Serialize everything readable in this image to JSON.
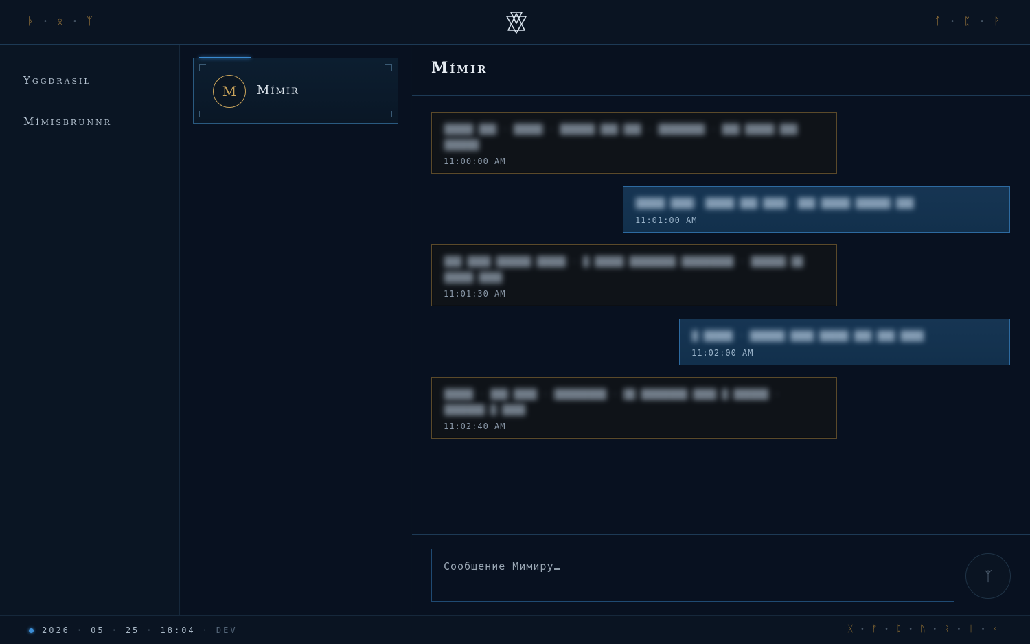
{
  "topbar": {
    "runes_left": [
      "ᚦ",
      "ᛟ",
      "ᛉ"
    ],
    "runes_right": [
      "ᛏ",
      "ᛈ",
      "ᚹ"
    ],
    "logo_icon": "valknut-icon"
  },
  "sidebar": {
    "items": [
      {
        "label": "Yggdrasil"
      },
      {
        "label": "Mímisbrunnr"
      }
    ]
  },
  "contacts": {
    "items": [
      {
        "initial": "M",
        "name": "Mímir",
        "selected": true
      }
    ]
  },
  "chat": {
    "title": "Mímir",
    "messages": [
      {
        "direction": "in",
        "text": "█████ ███ · █████ · ██████ ███ ███ · ████████ · ███ █████ ███ ██████",
        "time": "11:00:00 AM"
      },
      {
        "direction": "out",
        "text": "█████ ████· █████ ███ ████· ███ █████ ██████ ███",
        "time": "11:01:00 AM"
      },
      {
        "direction": "in",
        "text": "███ ████ ██████ █████ · █ █████ ████████ █████████ · ██████ ██ █████ ████",
        "time": "11:01:30 AM"
      },
      {
        "direction": "out",
        "text": "█ █████ · ██████ ████ █████ ███ ███ ████",
        "time": "11:02:00 AM"
      },
      {
        "direction": "in",
        "text": "█████ · ███ ████ · █████████ · ██ ████████ ████ █ ██████ · ███████ █ ████",
        "time": "11:02:40 AM"
      }
    ],
    "composer": {
      "placeholder": "Сообщение Мимиру…",
      "send_icon": "algiz-rune-icon",
      "send_glyph": "ᛉ"
    }
  },
  "statusbar": {
    "year": "2026",
    "month": "05",
    "day": "25",
    "time": "18:04",
    "env": "DEV",
    "runes": [
      "ᚷ",
      "ᚠ",
      "ᛈ",
      "ᚢ",
      "ᚱ",
      "ᛁ",
      "ᚲ"
    ],
    "status_color": "#3c8ed6"
  },
  "colors": {
    "accent_gold": "#c9a35a",
    "accent_blue": "#2d6aa0",
    "background": "#081120"
  }
}
